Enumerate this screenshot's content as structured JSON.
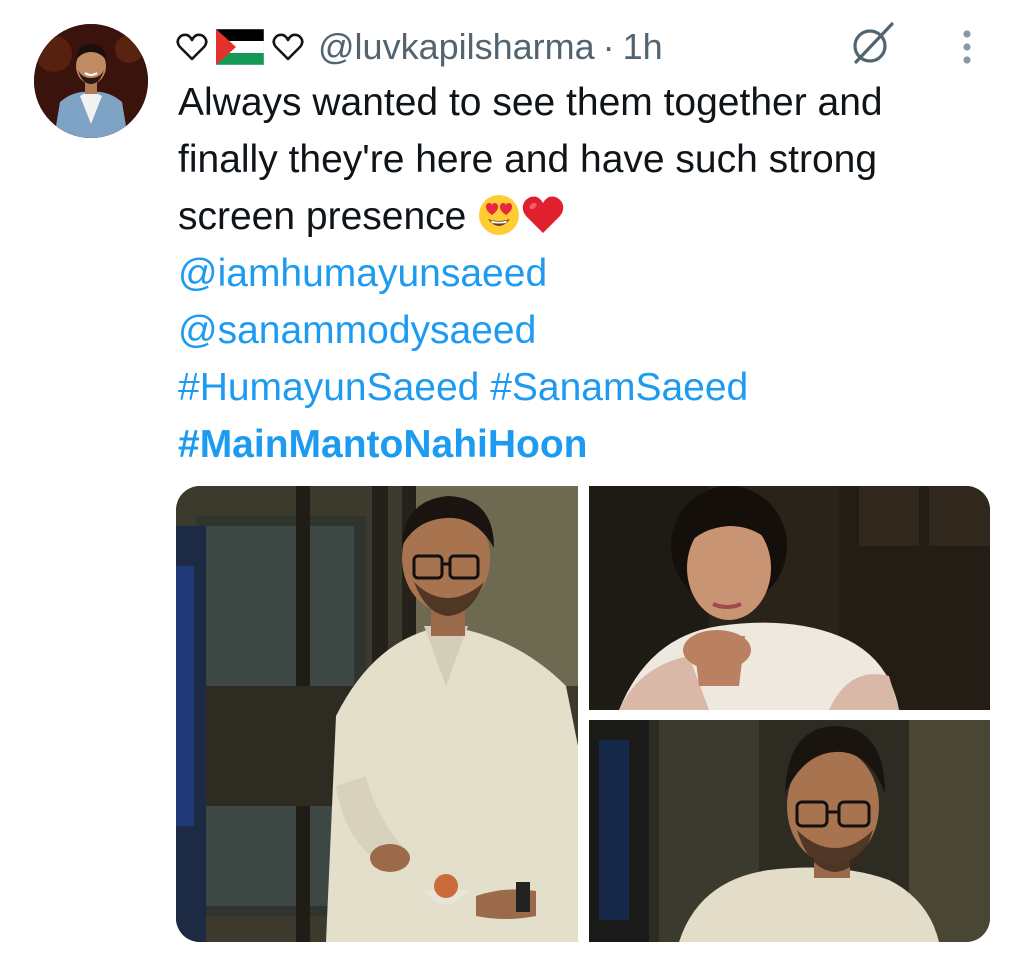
{
  "tweet": {
    "handle": "@luvkapilsharma",
    "separator": "·",
    "time": "1h",
    "name_icons": [
      "heart-outline-icon",
      "palestine-flag-icon",
      "heart-outline-icon"
    ],
    "text_lines": [
      "Always wanted to see them together and",
      "finally they're here and have such strong",
      "screen presence"
    ],
    "emojis": [
      "heart-eyes-emoji-icon",
      "red-heart-emoji-icon"
    ],
    "mentions": [
      "@iamhumayunsaeed",
      "@sanammodysaeed"
    ],
    "hashtags": [
      "#HumayunSaeed",
      "#SanamSaeed"
    ],
    "bold_hashtag": "#MainMantoNahiHoon"
  },
  "media": {
    "image_count": 3
  },
  "colors": {
    "text": "#0f1419",
    "secondary": "#536471",
    "link": "#1d9bf0"
  }
}
